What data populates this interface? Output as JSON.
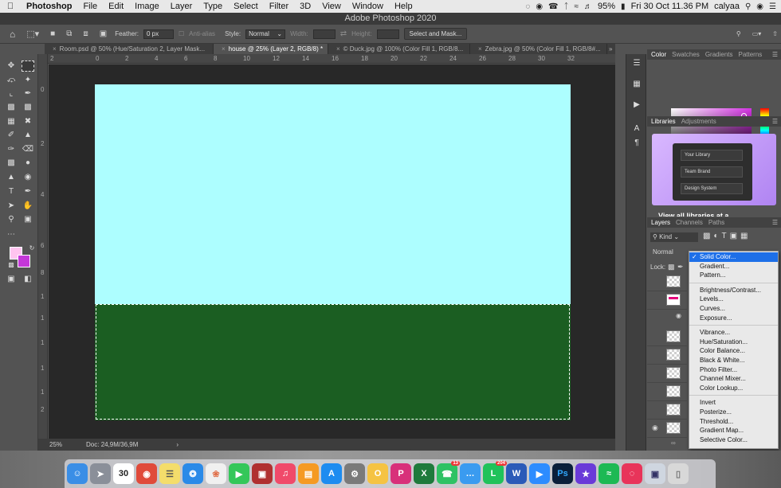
{
  "menubar": {
    "app": "Photoshop",
    "items": [
      "File",
      "Edit",
      "Image",
      "Layer",
      "Type",
      "Select",
      "Filter",
      "3D",
      "View",
      "Window",
      "Help"
    ],
    "battery": "95%",
    "datetime": "Fri 30 Oct  11.36 PM",
    "user": "calyaa"
  },
  "titlebar": {
    "title": "Adobe Photoshop 2020"
  },
  "options": {
    "feather_label": "Feather:",
    "feather_value": "0 px",
    "antialias_label": "Anti-alias",
    "style_label": "Style:",
    "style_value": "Normal",
    "width_label": "Width:",
    "height_label": "Height:",
    "select_mask_label": "Select and Mask..."
  },
  "tabs": [
    "Room.psd @ 50% (Hue/Saturation 2, Layer Mask...",
    "house @ 25% (Layer 2, RGB/8) *",
    "© Duck.jpg @ 100% (Color Fill 1, RGB/8...",
    "Zebra.jpg @ 50% (Color Fill 1, RGB/8#..."
  ],
  "rulers": {
    "top": [
      "2",
      "0",
      "2",
      "4",
      "6",
      "8",
      "10",
      "12",
      "14",
      "16",
      "18",
      "20",
      "22",
      "24",
      "26",
      "28",
      "30",
      "32"
    ],
    "left": [
      "0",
      "2",
      "4",
      "6",
      "8",
      "1",
      "1",
      "1",
      "1",
      "1",
      "2"
    ]
  },
  "status": {
    "zoom": "25%",
    "doc": "Doc: 24,9M/36,9M"
  },
  "colors": {
    "foreground": "#ffc4f0",
    "background": "#c437d8",
    "sky": "#adfeff",
    "grass": "#1b5e22",
    "menu_highlight": "#1d6fe8"
  },
  "panels": {
    "color_tabs": [
      "Color",
      "Swatches",
      "Gradients",
      "Patterns"
    ],
    "library_tabs": [
      "Libraries",
      "Adjustments"
    ],
    "library_rows": [
      "Your Library",
      "Team Brand",
      "Design System"
    ],
    "library_link": "View all libraries at a...",
    "layers_tabs": [
      "Layers",
      "Channels",
      "Paths"
    ],
    "kind_label": "Kind",
    "blend_mode": "Normal",
    "lock_label": "Lock:"
  },
  "adjust_menu": {
    "groups": [
      [
        "Solid Color...",
        "Gradient...",
        "Pattern..."
      ],
      [
        "Brightness/Contrast...",
        "Levels...",
        "Curves...",
        "Exposure..."
      ],
      [
        "Vibrance...",
        "Hue/Saturation...",
        "Color Balance...",
        "Black & White...",
        "Photo Filter...",
        "Channel Mixer...",
        "Color Lookup..."
      ],
      [
        "Invert",
        "Posterize...",
        "Threshold...",
        "Gradient Map...",
        "Selective Color..."
      ]
    ],
    "selected": "Solid Color..."
  },
  "dock": {
    "calendar_day": "30",
    "badge_whatsapp": "13",
    "badge_line": "204",
    "apps": [
      "finder-icon",
      "launchpad-icon",
      "calendar-icon",
      "chrome-icon",
      "notes-icon",
      "safari-icon",
      "photos-icon",
      "facetime-icon",
      "photo-booth-icon",
      "music-icon",
      "books-icon",
      "app-store-icon",
      "system-preferences-icon",
      "o-icon",
      "picsart-icon",
      "x-icon",
      "whatsapp-icon",
      "messages-icon",
      "line-icon",
      "word-icon",
      "zoom-icon",
      "photoshop-icon",
      "star-icon",
      "spotify-icon",
      "creative-cloud-icon",
      "preview-icon",
      "trash-icon"
    ]
  }
}
